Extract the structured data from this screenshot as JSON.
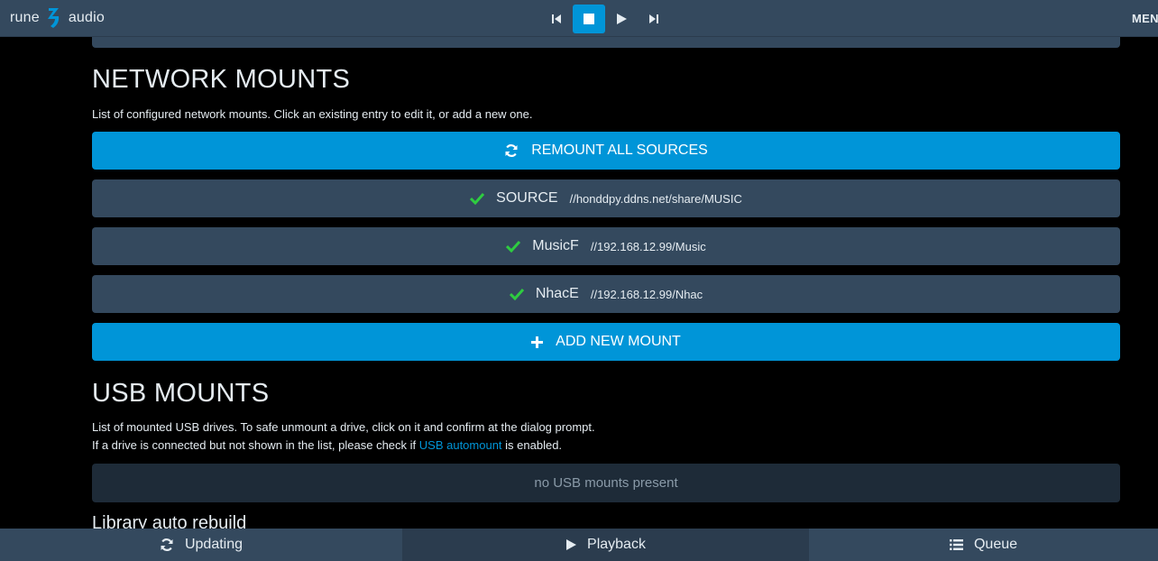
{
  "header": {
    "logo_left": "rune",
    "logo_right": "audio",
    "menu_label": "MENU"
  },
  "network": {
    "title": "NETWORK MOUNTS",
    "description": "List of configured network mounts. Click an existing entry to edit it, or add a new one.",
    "remount_label": "REMOUNT ALL SOURCES",
    "mounts": [
      {
        "name": "SOURCE",
        "path": "//honddpy.ddns.net/share/MUSIC"
      },
      {
        "name": "MusicF",
        "path": "//192.168.12.99/Music"
      },
      {
        "name": "NhacE",
        "path": "//192.168.12.99/Nhac"
      }
    ],
    "add_label": "ADD NEW MOUNT"
  },
  "usb": {
    "title": "USB MOUNTS",
    "description_line1": "List of mounted USB drives. To safe unmount a drive, click on it and confirm at the dialog prompt.",
    "description_line2_pre": "If a drive is connected but not shown in the list, please check if ",
    "description_link": "USB automount",
    "description_line2_post": " is enabled.",
    "empty_text": "no USB mounts present"
  },
  "library": {
    "title": "Library auto rebuild"
  },
  "footer": {
    "tabs": [
      {
        "label": "Updating",
        "icon": "refresh-icon"
      },
      {
        "label": "Playback",
        "icon": "play-icon"
      },
      {
        "label": "Queue",
        "icon": "list-icon"
      }
    ]
  },
  "colors": {
    "accent": "#0095d8",
    "panel": "#34495e",
    "ok_green": "#2ecc40"
  }
}
